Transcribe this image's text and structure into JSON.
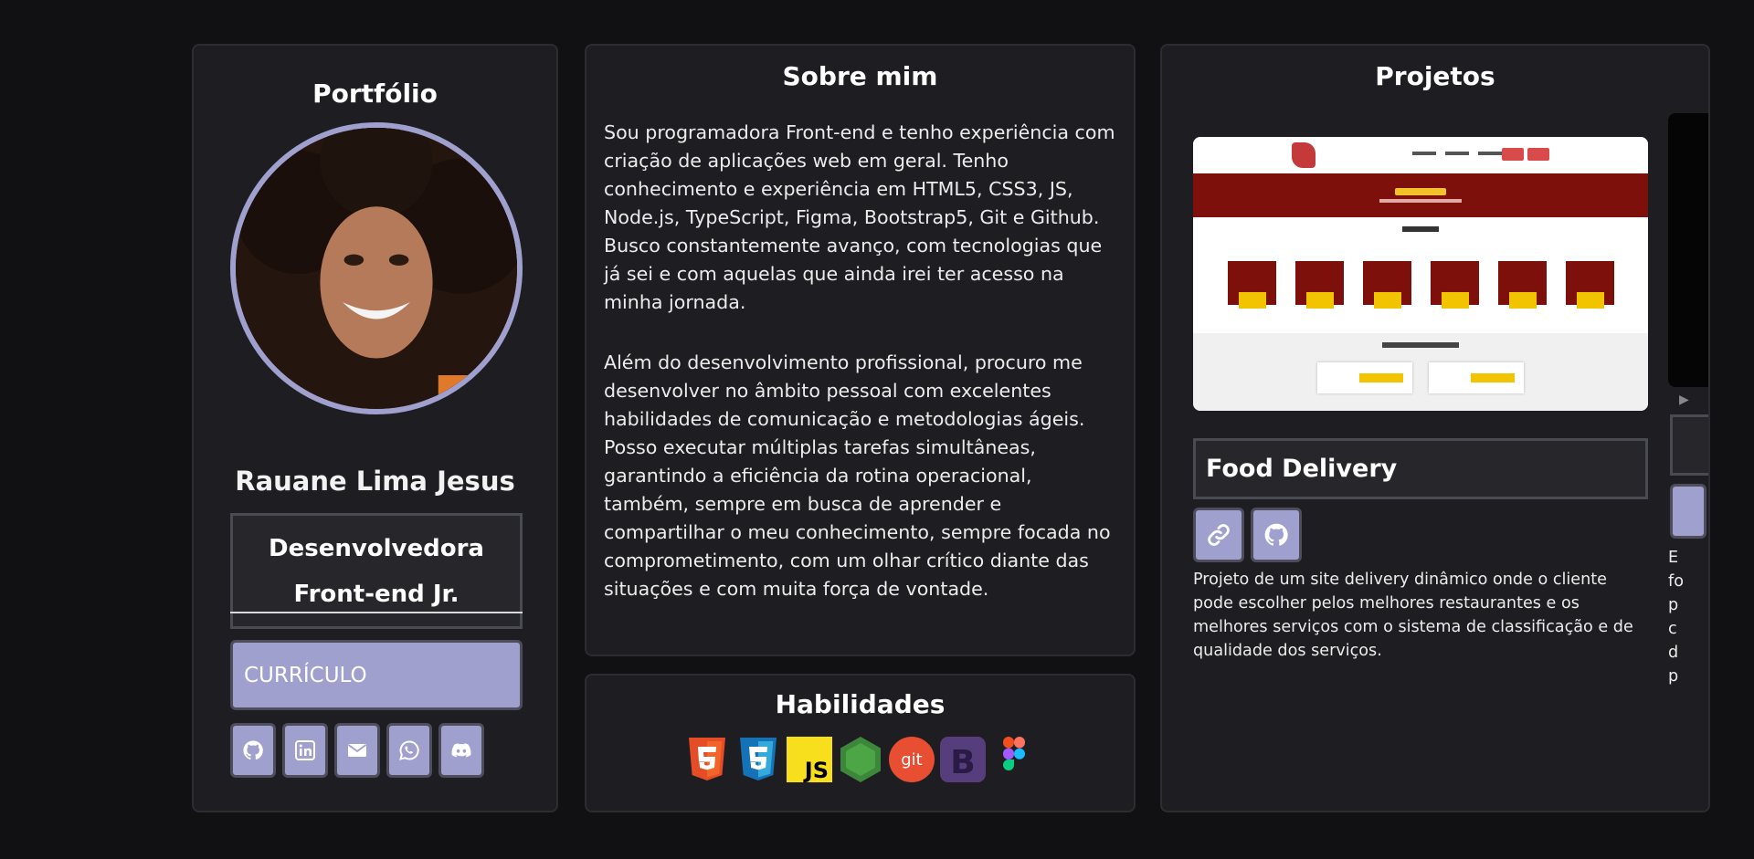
{
  "profile": {
    "title": "Portfólio",
    "name": "Rauane Lima Jesus",
    "role_line1": "Desenvolvedora",
    "role_line2": "Front-end Jr.",
    "cv_button": "CURRÍCULO",
    "social_icons": [
      "github-icon",
      "linkedin-icon",
      "email-icon",
      "whatsapp-icon",
      "discord-icon"
    ]
  },
  "about": {
    "title": "Sobre mim",
    "paragraph1": "Sou programadora Front-end e tenho experiência com criação de aplicações web em geral. Tenho conhecimento e experiência em HTML5, CSS3, JS, Node.js, TypeScript, Figma, Bootstrap5, Git e Github. Busco constantemente avanço, com tecnologias que já sei e com aquelas que ainda irei ter acesso na minha jornada.",
    "paragraph2": "Além do desenvolvimento profissional, procuro me desenvolver no âmbito pessoal com excelentes habilidades de comunicação e metodologias ágeis. Posso executar múltiplas tarefas simultâneas, garantindo a eficiência da rotina operacional, também, sempre em busca de aprender e compartilhar o meu conhecimento, sempre focada no comprometimento, com um olhar crítico diante das situações e com muita força de vontade."
  },
  "skills": {
    "title": "Habilidades",
    "icons": [
      "html5-icon",
      "css3-icon",
      "javascript-icon",
      "nodejs-icon",
      "git-icon",
      "bootstrap-icon",
      "figma-icon"
    ]
  },
  "projects": {
    "title": "Projetos",
    "current": {
      "name": "Food Delivery",
      "description": "Projeto de um site delivery dinâmico onde o cliente pode escolher pelos melhores restaurantes e os melhores serviços com o sistema de classificação e de qualidade dos serviços.",
      "link_icons": [
        "link-icon",
        "github-icon"
      ]
    },
    "peek_text": "E\nfo\np\nc\nd\np"
  },
  "colors": {
    "background": "#111113",
    "card": "#1e1e22",
    "accent": "#a0a0cf"
  }
}
